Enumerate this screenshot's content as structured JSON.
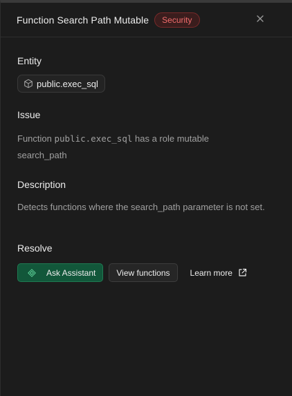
{
  "header": {
    "title": "Function Search Path Mutable",
    "badge": "Security",
    "close_icon": "close-icon"
  },
  "entity": {
    "heading": "Entity",
    "name": "public.exec_sql",
    "icon": "cube-icon"
  },
  "issue": {
    "heading": "Issue",
    "prefix": "Function",
    "code": "public.exec_sql",
    "suffix": "has a role mutable",
    "line2": "search_path"
  },
  "description": {
    "heading": "Description",
    "text": "Detects functions where the search_path parameter is not set."
  },
  "resolve": {
    "heading": "Resolve",
    "ask_assistant": "Ask Assistant",
    "view_functions": "View functions",
    "learn_more": "Learn more"
  },
  "colors": {
    "background": "#1c1c1c",
    "badge_text": "#f26d6d",
    "primary_button": "#12573a"
  }
}
